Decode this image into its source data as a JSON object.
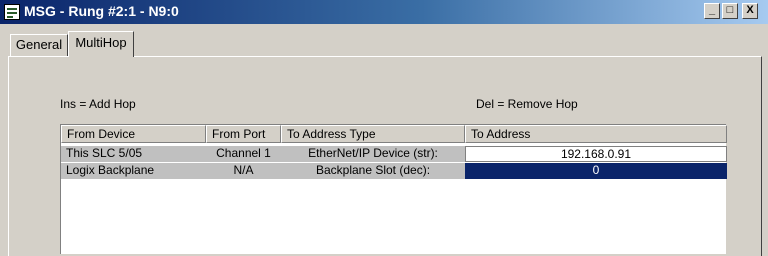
{
  "window": {
    "title": "MSG - Rung #2:1 - N9:0",
    "minimize_glyph": "_",
    "maximize_glyph": "□",
    "close_glyph": "X"
  },
  "tabs": [
    {
      "label": "General",
      "active": false
    },
    {
      "label": "MultiHop",
      "active": true
    }
  ],
  "hints": {
    "add": "Ins = Add Hop",
    "remove": "Del = Remove Hop"
  },
  "table": {
    "columns": [
      "From Device",
      "From Port",
      "To Address Type",
      "To Address"
    ],
    "rows": [
      {
        "from_device": "This SLC 5/05",
        "from_port": "Channel  1",
        "to_address_type": "EtherNet/IP Device (str):",
        "to_address": "192.168.0.91"
      },
      {
        "from_device": "Logix Backplane",
        "from_port": "N/A",
        "to_address_type": "Backplane Slot (dec):",
        "to_address": "0"
      }
    ]
  },
  "colors": {
    "title_bar": "#0a246a",
    "selection": "#0a246a",
    "face": "#d4d0c8"
  }
}
